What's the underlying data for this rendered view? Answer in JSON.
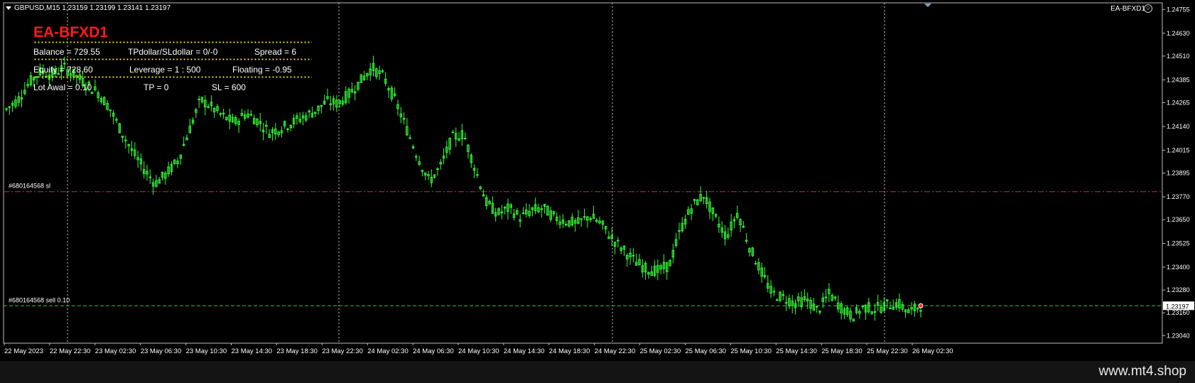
{
  "header": {
    "symbol_info": "GBPUSD,M15  1.23159 1.23199 1.23141 1.23197",
    "ea_name": "EA-BFXD1"
  },
  "panel": {
    "title": "EA-BFXD1",
    "row1": {
      "balance": "Balance = 729.55",
      "tp_sl": "TPdollar/SLdollar = 0/-0",
      "spread": "Spread  = 6"
    },
    "row2": {
      "equity": "Equity = 728.60",
      "leverage": "Leverage = 1 : 500",
      "floating": "Floating = -0.95"
    },
    "row3": {
      "lot": "Lot Awal  = 0.10",
      "tp": "TP = 0",
      "sl": "SL = 600"
    }
  },
  "watermark": "www.mt4.shop",
  "colors": {
    "candle": "#33ff33",
    "sl_line": "#d9262a",
    "order_line": "#3fbf3f",
    "panel_title": "#ff1a1a",
    "stars": "#ffe600",
    "grid": "#c8c8c8"
  },
  "chart_data": {
    "type": "candlestick",
    "symbol": "GBPUSD",
    "timeframe": "M15",
    "ohlc_current": {
      "open": 1.23159,
      "high": 1.23199,
      "low": 1.23141,
      "close": 1.23197
    },
    "price_ticks": [
      "1.24755",
      "1.24630",
      "1.24510",
      "1.24385",
      "1.24265",
      "1.24140",
      "1.24015",
      "1.23895",
      "1.23770",
      "1.23650",
      "1.23525",
      "1.23400",
      "1.23280",
      "1.23160",
      "1.23040"
    ],
    "time_ticks": [
      "22 May 2023",
      "22 May 22:30",
      "23 May 02:30",
      "23 May 06:30",
      "23 May 10:30",
      "23 May 14:30",
      "23 May 18:30",
      "23 May 22:30",
      "24 May 02:30",
      "24 May 06:30",
      "24 May 10:30",
      "24 May 14:30",
      "24 May 18:30",
      "24 May 22:30",
      "25 May 02:30",
      "25 May 06:30",
      "25 May 10:30",
      "25 May 14:30",
      "25 May 18:30",
      "25 May 22:30",
      "26 May 02:30"
    ],
    "ylim": [
      1.23,
      1.2479
    ],
    "current_price_label": "1.23197",
    "horizontal_lines": [
      {
        "label": "#680164568 sl",
        "price": 1.23797,
        "style": "dash-dot"
      },
      {
        "label": "#680164568 sell 0.10",
        "price": 1.23197,
        "style": "dashed"
      }
    ],
    "price_path": [
      [
        0,
        1.2423
      ],
      [
        2,
        1.2428
      ],
      [
        4,
        1.2437
      ],
      [
        6,
        1.2443
      ],
      [
        8,
        1.2441
      ],
      [
        10,
        1.2445
      ],
      [
        12,
        1.2441
      ],
      [
        14,
        1.2436
      ],
      [
        16,
        1.2432
      ],
      [
        18,
        1.2424
      ],
      [
        20,
        1.2412
      ],
      [
        22,
        1.2401
      ],
      [
        24,
        1.2392
      ],
      [
        26,
        1.2384
      ],
      [
        28,
        1.2389
      ],
      [
        30,
        1.2396
      ],
      [
        32,
        1.2412
      ],
      [
        34,
        1.2428
      ],
      [
        36,
        1.2424
      ],
      [
        38,
        1.2419
      ],
      [
        40,
        1.2416
      ],
      [
        42,
        1.2421
      ],
      [
        44,
        1.2417
      ],
      [
        46,
        1.2411
      ],
      [
        48,
        1.2413
      ],
      [
        50,
        1.2416
      ],
      [
        52,
        1.2419
      ],
      [
        54,
        1.2422
      ],
      [
        56,
        1.2427
      ],
      [
        58,
        1.2426
      ],
      [
        60,
        1.2431
      ],
      [
        62,
        1.2438
      ],
      [
        64,
        1.2445
      ],
      [
        66,
        1.244
      ],
      [
        68,
        1.2428
      ],
      [
        70,
        1.2413
      ],
      [
        72,
        1.2398
      ],
      [
        74,
        1.2385
      ],
      [
        76,
        1.2393
      ],
      [
        78,
        1.2408
      ],
      [
        80,
        1.241
      ],
      [
        82,
        1.2392
      ],
      [
        84,
        1.2374
      ],
      [
        86,
        1.2368
      ],
      [
        88,
        1.2371
      ],
      [
        90,
        1.2366
      ],
      [
        92,
        1.237
      ],
      [
        94,
        1.2371
      ],
      [
        96,
        1.2366
      ],
      [
        98,
        1.2364
      ],
      [
        100,
        1.2363
      ],
      [
        102,
        1.2367
      ],
      [
        104,
        1.2363
      ],
      [
        106,
        1.2355
      ],
      [
        108,
        1.2349
      ],
      [
        110,
        1.2343
      ],
      [
        112,
        1.2339
      ],
      [
        114,
        1.2338
      ],
      [
        116,
        1.2341
      ],
      [
        118,
        1.236
      ],
      [
        120,
        1.2372
      ],
      [
        122,
        1.2378
      ],
      [
        124,
        1.2366
      ],
      [
        126,
        1.2356
      ],
      [
        128,
        1.2369
      ],
      [
        130,
        1.2351
      ],
      [
        132,
        1.2338
      ],
      [
        134,
        1.2326
      ],
      [
        136,
        1.2324
      ],
      [
        138,
        1.2321
      ],
      [
        140,
        1.2323
      ],
      [
        142,
        1.2317
      ],
      [
        144,
        1.2326
      ],
      [
        146,
        1.2319
      ],
      [
        148,
        1.2314
      ],
      [
        150,
        1.2319
      ],
      [
        152,
        1.2318
      ],
      [
        154,
        1.232
      ],
      [
        156,
        1.2321
      ],
      [
        158,
        1.2316
      ],
      [
        160,
        1.232
      ]
    ]
  }
}
